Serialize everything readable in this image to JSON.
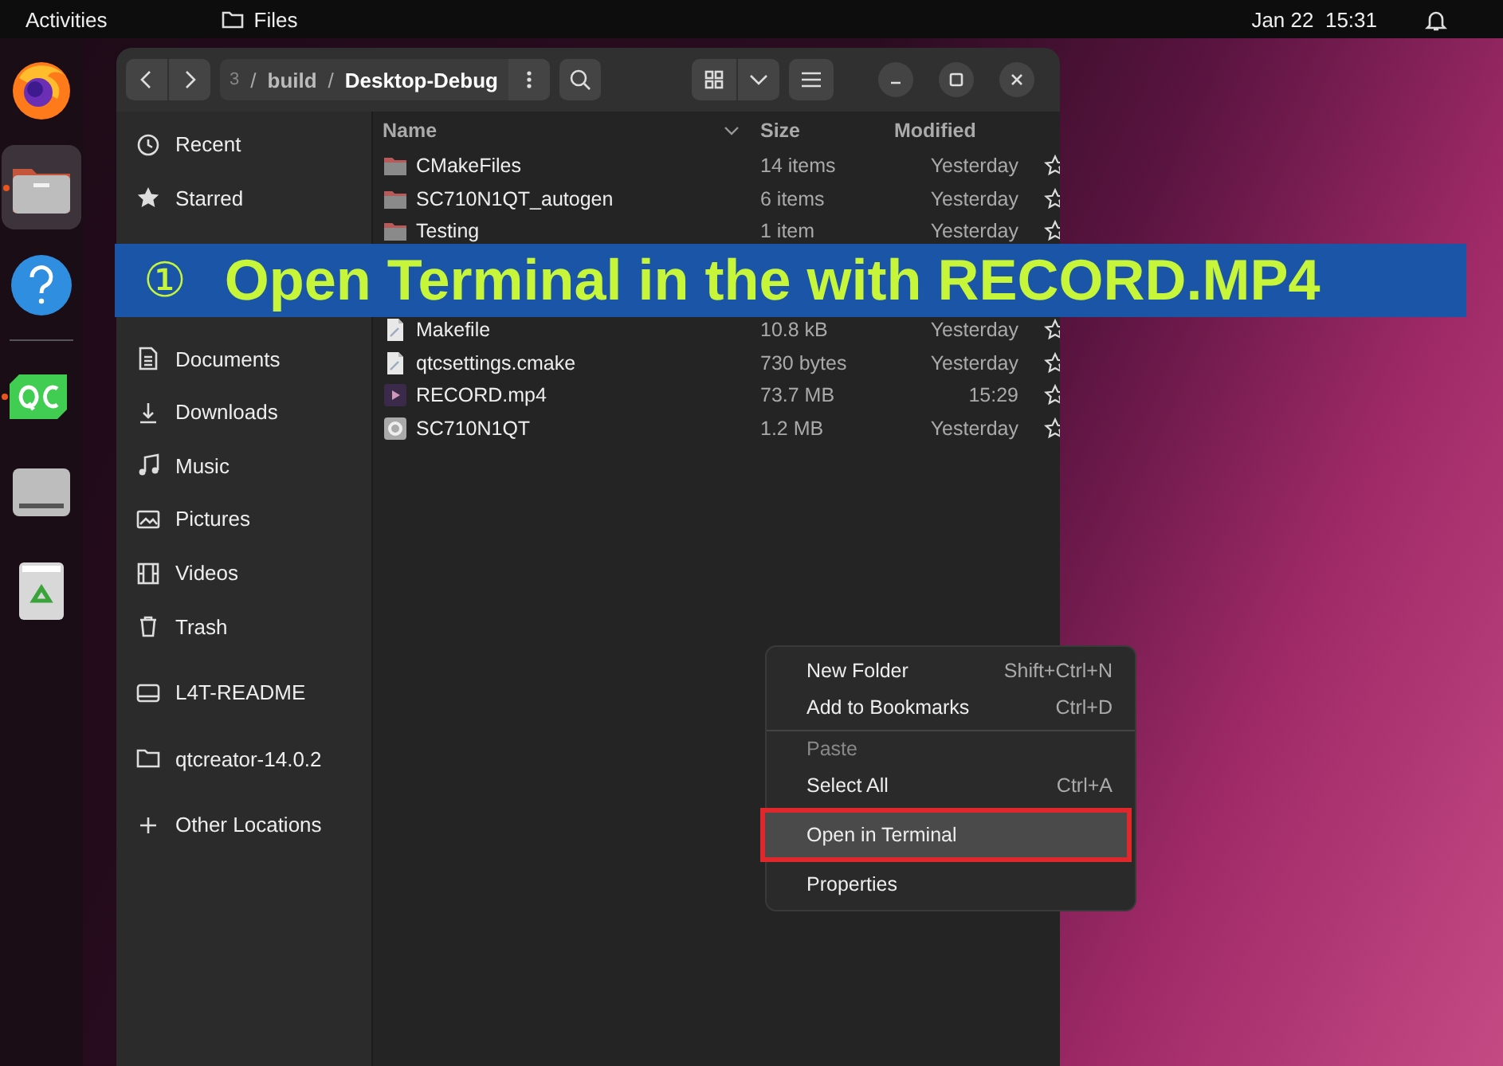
{
  "top_bar": {
    "activities": "Activities",
    "app": "Files",
    "date": "Jan 22",
    "time": "15:31"
  },
  "dock": {
    "items": [
      {
        "kind": "firefox",
        "running": false,
        "selected": false
      },
      {
        "kind": "files",
        "running": true,
        "selected": true
      },
      {
        "kind": "help",
        "running": false,
        "selected": false
      },
      {
        "kind": "qtcreator",
        "running": true,
        "selected": false
      },
      {
        "kind": "drive",
        "running": false,
        "selected": false
      },
      {
        "kind": "trash",
        "running": false,
        "selected": false
      }
    ]
  },
  "files_window": {
    "path": [
      {
        "kind": "dim",
        "text": "3"
      },
      {
        "kind": "sep",
        "text": "/"
      },
      {
        "kind": "crumb",
        "text": "build"
      },
      {
        "kind": "sep",
        "text": "/"
      },
      {
        "kind": "current",
        "text": "Desktop-Debug"
      }
    ],
    "sidebar": {
      "places_above_caption": [
        {
          "kind": "recent",
          "label": "Recent"
        },
        {
          "kind": "starred",
          "label": "Starred"
        }
      ],
      "places_below_caption": [
        {
          "kind": "documents",
          "label": "Documents"
        },
        {
          "kind": "downloads",
          "label": "Downloads"
        },
        {
          "kind": "music",
          "label": "Music"
        },
        {
          "kind": "pictures",
          "label": "Pictures"
        },
        {
          "kind": "videos",
          "label": "Videos"
        },
        {
          "kind": "trash",
          "label": "Trash"
        }
      ],
      "devices": [
        {
          "kind": "drive",
          "label": "L4T-README"
        },
        {
          "kind": "folder",
          "label": "qtcreator-14.0.2"
        },
        {
          "kind": "plus",
          "label": "Other Locations"
        }
      ]
    },
    "table": {
      "columns": [
        "Name",
        "Size",
        "Modified"
      ],
      "rows_above_caption": [
        {
          "kind": "folder",
          "name": "CMakeFiles",
          "size": "14 items",
          "modified": "Yesterday",
          "starred": false
        },
        {
          "kind": "folder",
          "name": "SC710N1QT_autogen",
          "size": "6 items",
          "modified": "Yesterday",
          "starred": false
        },
        {
          "kind": "folder",
          "name": "Testing",
          "size": "1 item",
          "modified": "Yesterday",
          "starred": false
        }
      ],
      "rows_below_caption": [
        {
          "kind": "text",
          "name": "Makefile",
          "size": "10.8 kB",
          "modified": "Yesterday",
          "starred": false
        },
        {
          "kind": "text",
          "name": "qtcsettings.cmake",
          "size": "730 bytes",
          "modified": "Yesterday",
          "starred": false
        },
        {
          "kind": "video",
          "name": "RECORD.mp4",
          "size": "73.7 MB",
          "modified": "15:29",
          "starred": false
        },
        {
          "kind": "binary",
          "name": "SC710N1QT",
          "size": "1.2 MB",
          "modified": "Yesterday",
          "starred": false
        }
      ]
    }
  },
  "context_menu": {
    "items": [
      {
        "label": "New Folder",
        "shortcut": "Shift+Ctrl+N",
        "disabled": false,
        "selected": false,
        "divider_before": false,
        "highlighted": false
      },
      {
        "label": "Add to Bookmarks",
        "shortcut": "Ctrl+D",
        "disabled": false,
        "selected": false,
        "divider_before": false,
        "highlighted": false
      },
      {
        "label": "Paste",
        "disabled": true,
        "selected": false,
        "divider_before": true,
        "highlighted": false
      },
      {
        "label": "Select All",
        "shortcut": "Ctrl+A",
        "disabled": false,
        "selected": false,
        "divider_before": false,
        "highlighted": false
      },
      {
        "label": "Open in Terminal",
        "disabled": false,
        "selected": true,
        "divider_before": false,
        "highlighted": true
      },
      {
        "label": "Properties",
        "disabled": false,
        "selected": false,
        "divider_before": false,
        "highlighted": false
      }
    ]
  },
  "caption": {
    "number": "①",
    "text": "Open Terminal in the with RECORD.MP4"
  }
}
